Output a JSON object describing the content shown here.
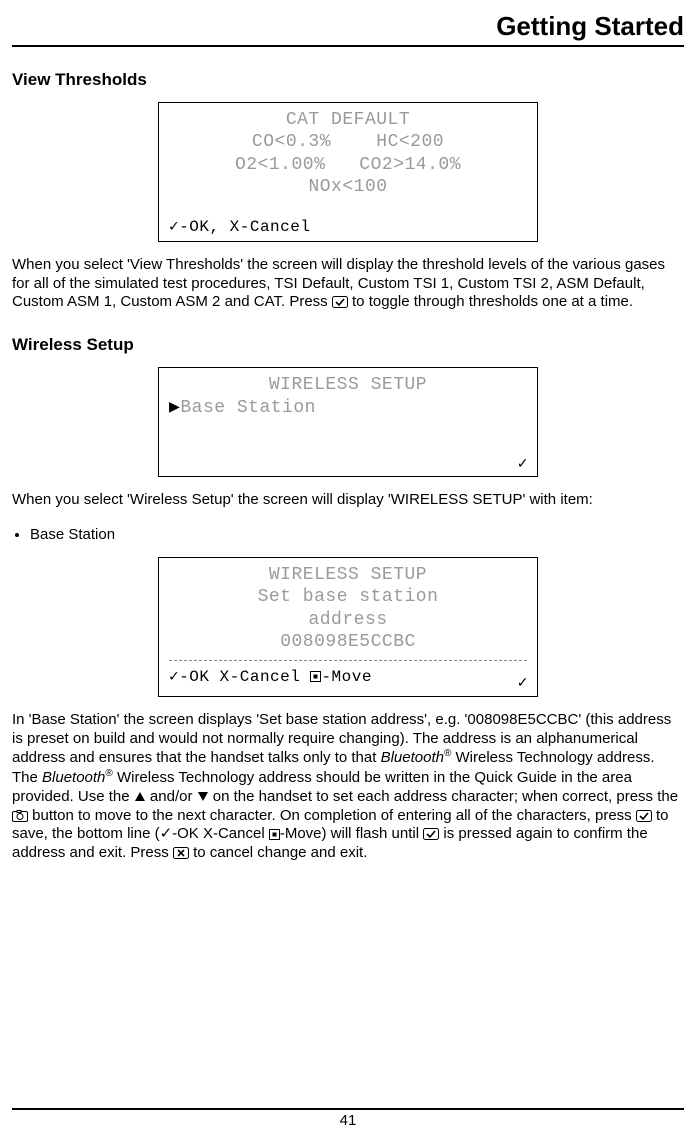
{
  "chapter": "Getting Started",
  "sections": {
    "viewThresholds": {
      "heading": "View Thresholds",
      "lcd": {
        "title": "CAT DEFAULT",
        "row1a": "CO<0.3%",
        "row1b": "HC<200",
        "row2a": "O2<1.00%",
        "row2b": "CO2>14.0%",
        "row3": "NOx<100",
        "footer": "✓-OK, X-Cancel"
      },
      "paraPrefix": "When you select 'View Thresholds' the screen will display the threshold levels of the various gases for all of the simulated test procedures, TSI Default, Custom TSI 1, Custom TSI 2, ASM Default, Custom ASM 1, Custom ASM 2 and CAT. Press ",
      "paraSuffix": " to toggle through thresholds one at a time."
    },
    "wirelessSetup": {
      "heading": "Wireless Setup",
      "lcd1": {
        "title": "WIRELESS SETUP",
        "item": "Base Station"
      },
      "paraIntro": "When you select 'Wireless Setup' the screen will display 'WIRELESS SETUP' with item:",
      "bullet": "Base Station",
      "lcd2": {
        "title": "WIRELESS SETUP",
        "line1": "Set base station",
        "line2": "address",
        "line3": "008098E5CCBC",
        "footerPrefix": "✓-OK X-Cancel ",
        "footerSuffix": "-Move"
      },
      "baseStation": {
        "t1": "In 'Base Station' the screen displays 'Set base station address', e.g. '008098E5CCBC' (this address is preset on build and would not normally require changing). The address is an alphanumerical address and ensures that the handset talks only to that ",
        "bt1": "Bluetooth",
        "reg": "®",
        "t2": " Wireless Technology address. The ",
        "bt2": "Bluetooth",
        "t3": " Wireless Technology address should be written in the Quick Guide in the area provided. Use the ",
        "t4": " and/or ",
        "t5": " on the handset to set each address character; when correct, press the ",
        "t6": " button to move to the next character. On completion of entering all of the characters, press ",
        "t7": " to save, the bottom line (✓-OK X-Cancel ",
        "t8": "-Move) will flash until ",
        "t9": " is pressed again to confirm the address and exit. Press ",
        "t10": " to cancel change and exit."
      }
    }
  },
  "pageNumber": "41"
}
